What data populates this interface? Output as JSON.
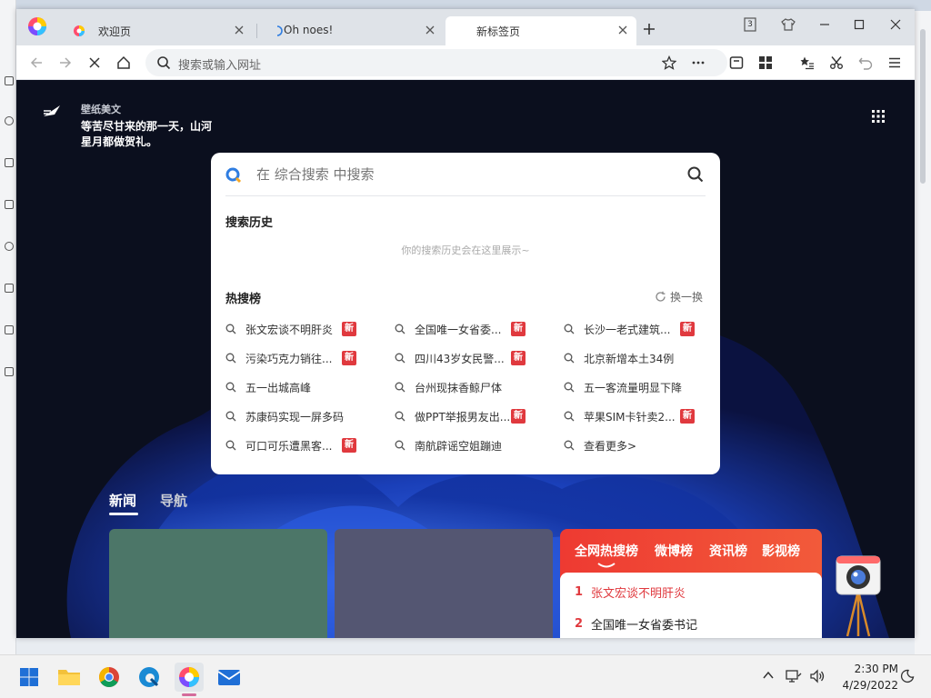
{
  "browser": {
    "tabs": [
      {
        "label": "欢迎页",
        "active": false
      },
      {
        "label": "Oh noes!",
        "active": false
      },
      {
        "label": "新标签页",
        "active": true
      }
    ],
    "tab_count_badge": "3",
    "address_placeholder": "搜索或输入网址"
  },
  "wallpaper": {
    "source": "壁纸美文",
    "text": "等苦尽甘来的那一天，山河星月都做贺礼。"
  },
  "search": {
    "placeholder": "在 综合搜索 中搜索",
    "history_title": "搜索历史",
    "history_empty": "你的搜索历史会在这里展示~",
    "hot_title": "热搜榜",
    "refresh_label": "换一换",
    "new_badge": "新",
    "hot_items": [
      {
        "text": "张文宏谈不明肝炎",
        "badge": true
      },
      {
        "text": "全国唯一女省委...",
        "badge": true
      },
      {
        "text": "长沙一老式建筑...",
        "badge": true
      },
      {
        "text": "污染巧克力销往...",
        "badge": true
      },
      {
        "text": "四川43岁女民警...",
        "badge": true
      },
      {
        "text": "北京新增本土34例",
        "badge": false
      },
      {
        "text": "五一出城高峰",
        "badge": false
      },
      {
        "text": "台州现抹香鲸尸体",
        "badge": false
      },
      {
        "text": "五一客流量明显下降",
        "badge": false
      },
      {
        "text": "苏康码实现一屏多码",
        "badge": false
      },
      {
        "text": "做PPT举报男友出...",
        "badge": true
      },
      {
        "text": "苹果SIM卡针卖2...",
        "badge": true
      },
      {
        "text": "可口可乐遭黑客...",
        "badge": true
      },
      {
        "text": "南航辟谣空姐蹦迪",
        "badge": false
      },
      {
        "text": "查看更多>",
        "badge": false
      }
    ]
  },
  "news_tabs": [
    "新闻",
    "导航"
  ],
  "hot_panel": {
    "tabs": [
      "全网热搜榜",
      "微博榜",
      "资讯榜",
      "影视榜"
    ],
    "items": [
      {
        "rank": "1",
        "text": "张文宏谈不明肝炎"
      },
      {
        "rank": "2",
        "text": "全国唯一女省委书记"
      }
    ]
  },
  "taskbar": {
    "time": "2:30 PM",
    "date": "4/29/2022",
    "apps": [
      "start-icon",
      "file-explorer-icon",
      "chrome-icon",
      "edge-icon",
      "browser-icon",
      "mail-icon"
    ]
  },
  "colors": {
    "accent_red": "#e0393e",
    "page_bg": "#0b0f1e",
    "news_card_1": "#4c7668",
    "news_card_2": "#545672"
  }
}
